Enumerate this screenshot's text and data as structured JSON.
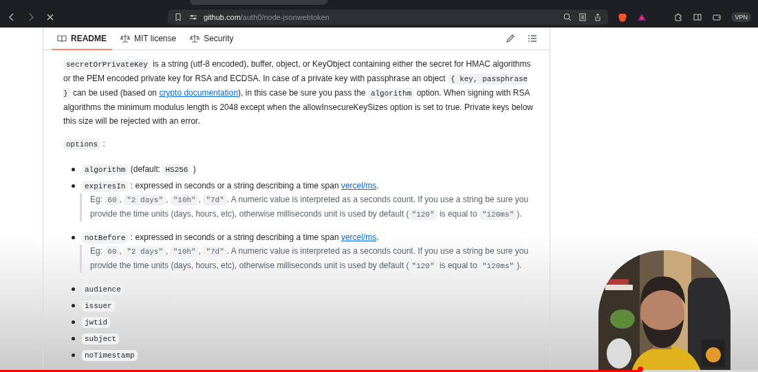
{
  "browser": {
    "url_host": "github.com",
    "url_path": "/auth0/node-jsonwebtoken",
    "vpn_label": "VPN"
  },
  "readme": {
    "tabs": [
      {
        "label": "README",
        "selected": true
      },
      {
        "label": "MIT license",
        "selected": false
      },
      {
        "label": "Security",
        "selected": false
      }
    ],
    "blocks": [
      {
        "kind": "paragraph",
        "segments": [
          {
            "kind": "code",
            "text": "secretOrPrivateKey"
          },
          {
            "kind": "text",
            "text": " is a string (utf-8 encoded), buffer, object, or KeyObject containing either the secret for HMAC algorithms or the PEM encoded private key for RSA and ECDSA. In case of a private key with passphrase an object "
          },
          {
            "kind": "code",
            "text": "{ key, passphrase }"
          },
          {
            "kind": "text",
            "text": " can be used (based on "
          },
          {
            "kind": "link",
            "text": "crypto documentation"
          },
          {
            "kind": "text",
            "text": "), in this case be sure you pass the "
          },
          {
            "kind": "code",
            "text": "algorithm"
          },
          {
            "kind": "text",
            "text": " option. When signing with RSA algorithms the minimum modulus length is 2048 except when the allowInsecureKeySizes option is set to true. Private keys below this size will be rejected with an error."
          }
        ]
      },
      {
        "kind": "paragraph",
        "segments": [
          {
            "kind": "code",
            "text": "options"
          },
          {
            "kind": "text",
            "text": " :"
          }
        ]
      },
      {
        "kind": "list",
        "items": [
          {
            "segments": [
              {
                "kind": "code",
                "text": "algorithm"
              },
              {
                "kind": "text",
                "text": " (default: "
              },
              {
                "kind": "code",
                "text": "HS256"
              },
              {
                "kind": "text",
                "text": " )"
              }
            ]
          },
          {
            "segments": [
              {
                "kind": "code",
                "text": "expiresIn"
              },
              {
                "kind": "text",
                "text": " : expressed in seconds or a string describing a time span "
              },
              {
                "kind": "link",
                "text": "vercel/ms"
              },
              {
                "kind": "text",
                "text": "."
              }
            ],
            "note": [
              {
                "kind": "text",
                "text": "Eg: "
              },
              {
                "kind": "code",
                "text": "60"
              },
              {
                "kind": "text",
                "text": ", "
              },
              {
                "kind": "code",
                "text": "\"2 days\""
              },
              {
                "kind": "text",
                "text": ", "
              },
              {
                "kind": "code",
                "text": "\"10h\""
              },
              {
                "kind": "text",
                "text": ", "
              },
              {
                "kind": "code",
                "text": "\"7d\""
              },
              {
                "kind": "text",
                "text": ". A numeric value is interpreted as a seconds count. If you use a string be sure you provide the time units (days, hours, etc), otherwise milliseconds unit is used by default ("
              },
              {
                "kind": "code",
                "text": "\"120\""
              },
              {
                "kind": "text",
                "text": " is equal to "
              },
              {
                "kind": "code",
                "text": "\"120ms\""
              },
              {
                "kind": "text",
                "text": ")."
              }
            ]
          },
          {
            "segments": [
              {
                "kind": "code",
                "text": "notBefore"
              },
              {
                "kind": "text",
                "text": " : expressed in seconds or a string describing a time span "
              },
              {
                "kind": "link",
                "text": "vercel/ms"
              },
              {
                "kind": "text",
                "text": "."
              }
            ],
            "note": [
              {
                "kind": "text",
                "text": "Eg: "
              },
              {
                "kind": "code",
                "text": "60"
              },
              {
                "kind": "text",
                "text": ", "
              },
              {
                "kind": "code",
                "text": "\"2 days\""
              },
              {
                "kind": "text",
                "text": ", "
              },
              {
                "kind": "code",
                "text": "\"10h\""
              },
              {
                "kind": "text",
                "text": ", "
              },
              {
                "kind": "code",
                "text": "\"7d\""
              },
              {
                "kind": "text",
                "text": ". A numeric value is interpreted as a seconds count. If you use a string be sure you provide the time units (days, hours, etc), otherwise milliseconds unit is used by default ("
              },
              {
                "kind": "code",
                "text": "\"120\""
              },
              {
                "kind": "text",
                "text": " is equal to "
              },
              {
                "kind": "code",
                "text": "\"120ms\""
              },
              {
                "kind": "text",
                "text": ")."
              }
            ]
          },
          {
            "segments": [
              {
                "kind": "code",
                "text": "audience"
              }
            ]
          },
          {
            "segments": [
              {
                "kind": "code",
                "text": "issuer"
              }
            ]
          },
          {
            "segments": [
              {
                "kind": "code",
                "text": "jwtid"
              }
            ]
          },
          {
            "segments": [
              {
                "kind": "code",
                "text": "subject"
              }
            ]
          },
          {
            "segments": [
              {
                "kind": "code",
                "text": "noTimestamp"
              }
            ]
          }
        ]
      }
    ]
  },
  "video": {
    "progress": {
      "level": 0.845
    }
  }
}
